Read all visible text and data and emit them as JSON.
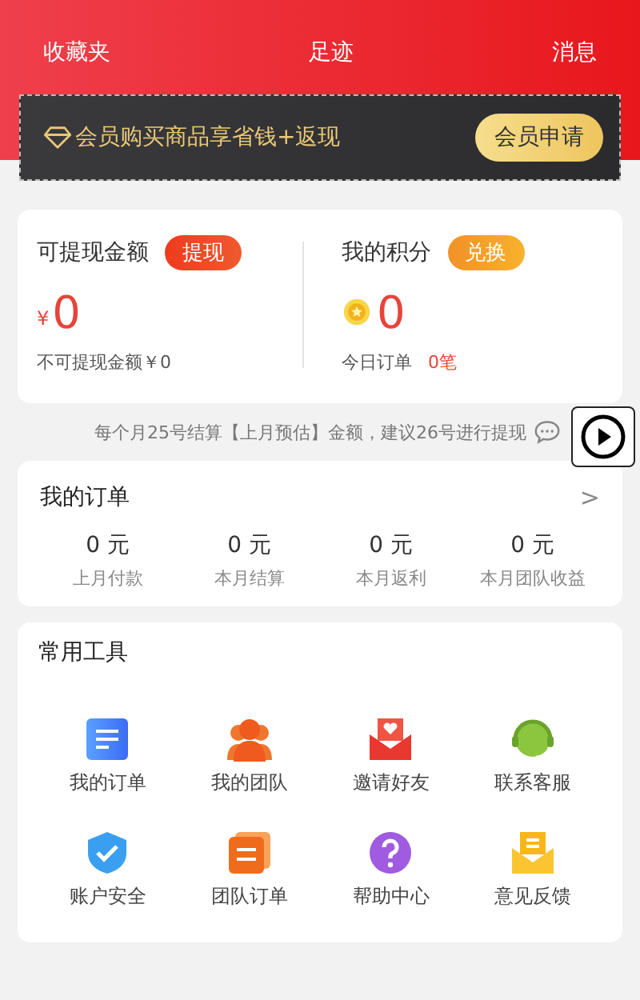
{
  "header_links": [
    "收藏夹",
    "足迹",
    "消息"
  ],
  "member_bar": {
    "text": "会员购买商品享省钱+返现",
    "button": "会员申请"
  },
  "balance": {
    "title": "可提现金额",
    "action": "提现",
    "currency": "¥",
    "amount": "0",
    "note": "不可提现金额￥0"
  },
  "points": {
    "title": "我的积分",
    "action": "兑换",
    "amount": "0",
    "note_label": "今日订单",
    "note_value": "0笔"
  },
  "settlement_note": "每个月25号结算【上月预估】金额，建议26号进行提现",
  "orders": {
    "title": "我的订单",
    "chevron": ">",
    "stats": [
      {
        "value": "0 元",
        "label": "上月付款"
      },
      {
        "value": "0 元",
        "label": "本月结算"
      },
      {
        "value": "0 元",
        "label": "本月返利"
      },
      {
        "value": "0 元",
        "label": "本月团队收益"
      }
    ]
  },
  "tools": {
    "title": "常用工具",
    "items": [
      {
        "kind": "orders",
        "label": "我的订单"
      },
      {
        "kind": "team",
        "label": "我的团队"
      },
      {
        "kind": "invite",
        "label": "邀请好友"
      },
      {
        "kind": "service",
        "label": "联系客服"
      },
      {
        "kind": "security",
        "label": "账户安全"
      },
      {
        "kind": "team_orders",
        "label": "团队订单"
      },
      {
        "kind": "help",
        "label": "帮助中心"
      },
      {
        "kind": "feedback",
        "label": "意见反馈"
      }
    ]
  }
}
